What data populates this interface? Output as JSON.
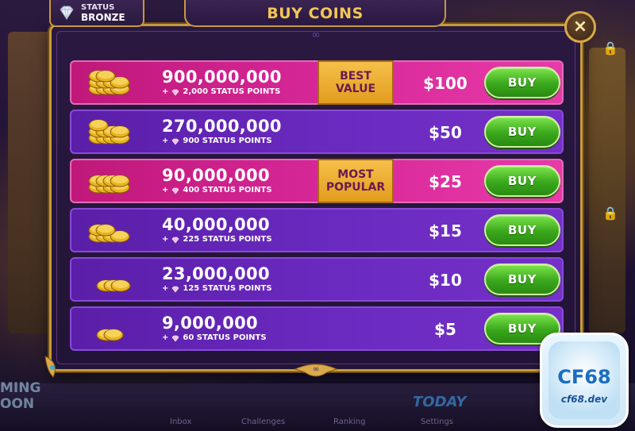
{
  "status": {
    "label": "STATUS",
    "tier": "BRONZE"
  },
  "header": {
    "title": "BUY COINS"
  },
  "close": {
    "glyph": "×"
  },
  "offers": [
    {
      "amount": "900,000,000",
      "points": "2,000 STATUS POINTS",
      "price": "$100",
      "badge": [
        "BEST",
        "VALUE"
      ],
      "style": "pink",
      "buy": "BUY"
    },
    {
      "amount": "270,000,000",
      "points": "900 STATUS POINTS",
      "price": "$50",
      "badge": null,
      "style": "purple",
      "buy": "BUY"
    },
    {
      "amount": "90,000,000",
      "points": "400 STATUS POINTS",
      "price": "$25",
      "badge": [
        "MOST",
        "POPULAR"
      ],
      "style": "pink",
      "buy": "BUY"
    },
    {
      "amount": "40,000,000",
      "points": "225 STATUS POINTS",
      "price": "$15",
      "badge": null,
      "style": "purple",
      "buy": "BUY"
    },
    {
      "amount": "23,000,000",
      "points": "125 STATUS POINTS",
      "price": "$10",
      "badge": null,
      "style": "purple",
      "buy": "BUY"
    },
    {
      "amount": "9,000,000",
      "points": "60 STATUS POINTS",
      "price": "$5",
      "badge": null,
      "style": "purple",
      "buy": "BUY"
    }
  ],
  "background": {
    "left_text": "MING\nOON",
    "today": "TODAY",
    "bottom_items": [
      "Inbox",
      "Challenges",
      "Ranking",
      "Settings"
    ]
  },
  "logo": {
    "main": "CF68",
    "sub": "cf68.dev"
  },
  "colors": {
    "gold": "#c79a3a",
    "title": "#f2c655",
    "pink_row": "#d8289a",
    "purple_row": "#6a2ac0",
    "buy_green": "#3aa81c",
    "badge_gold": "#f6c04a"
  },
  "icons": {
    "status": "diamond-icon",
    "close": "close-icon",
    "lock": "lock-icon",
    "coins": "coin-stack-icon"
  }
}
